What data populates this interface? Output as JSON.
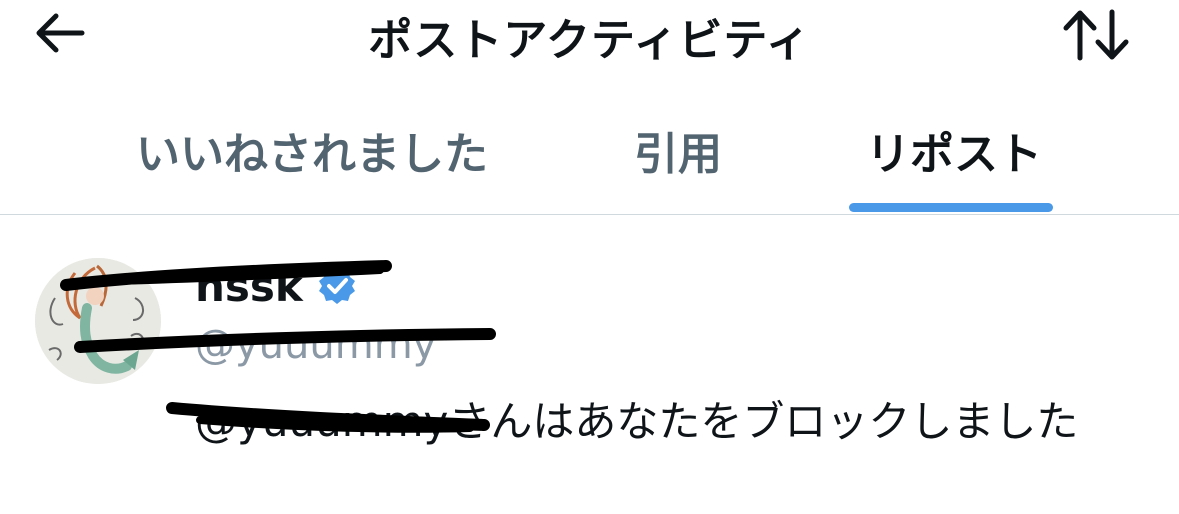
{
  "header": {
    "title": "ポストアクティビティ",
    "back_icon": "arrow-left-icon",
    "sort_icon": "sort-arrows-icon"
  },
  "tabs": [
    {
      "label": "いいねされました",
      "active": false
    },
    {
      "label": "引用",
      "active": false
    },
    {
      "label": "リポスト",
      "active": true
    }
  ],
  "accent_color": "#4a99e9",
  "user": {
    "name": "nssk",
    "handle": "@yuuummy",
    "verified": true,
    "blocked_message": "@yuuummyさんはあなたをブロックしました"
  }
}
